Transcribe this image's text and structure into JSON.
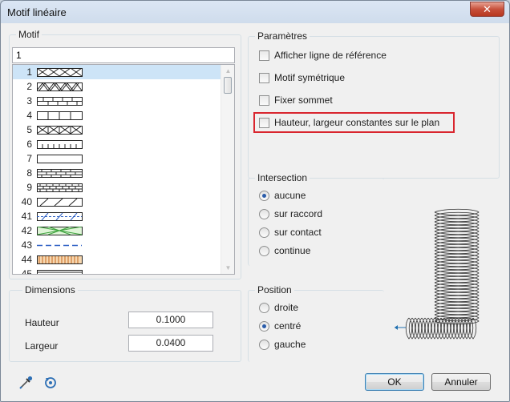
{
  "window": {
    "title": "Motif linéaire",
    "close_glyph": "✕"
  },
  "motif": {
    "group_title": "Motif",
    "search_value": "1",
    "items": [
      {
        "num": "1",
        "pattern": "diamond-lattice"
      },
      {
        "num": "2",
        "pattern": "zigzag-double"
      },
      {
        "num": "3",
        "pattern": "brick-double"
      },
      {
        "num": "4",
        "pattern": "rect-blocks"
      },
      {
        "num": "5",
        "pattern": "cross-blocks"
      },
      {
        "num": "6",
        "pattern": "comb"
      },
      {
        "num": "7",
        "pattern": "empty"
      },
      {
        "num": "8",
        "pattern": "brick-triple"
      },
      {
        "num": "9",
        "pattern": "brick-dense"
      },
      {
        "num": "40",
        "pattern": "diagonal-hatch"
      },
      {
        "num": "41",
        "pattern": "diagonal-blue"
      },
      {
        "num": "42",
        "pattern": "green-cross"
      },
      {
        "num": "43",
        "pattern": "dash-blue"
      },
      {
        "num": "44",
        "pattern": "orange-rail"
      },
      {
        "num": "45",
        "pattern": "stripes"
      }
    ]
  },
  "parametres": {
    "group_title": "Paramètres",
    "afficher_label": "Afficher ligne de référence",
    "symetrique_label": "Motif symétrique",
    "fixer_label": "Fixer sommet",
    "hauteur_constante_label": "Hauteur, largeur constantes sur le plan",
    "highlight_color": "#d9252e"
  },
  "intersection": {
    "group_title": "Intersection",
    "options": [
      "aucune",
      "sur raccord",
      "sur contact",
      "continue"
    ],
    "selected": "aucune"
  },
  "dimensions": {
    "group_title": "Dimensions",
    "hauteur_label": "Hauteur",
    "hauteur_value": "0.1000",
    "largeur_label": "Largeur",
    "largeur_value": "0.0400"
  },
  "position": {
    "group_title": "Position",
    "options": [
      "droite",
      "centré",
      "gauche"
    ],
    "selected": "centré"
  },
  "footer": {
    "ok_label": "OK",
    "cancel_label": "Annuler",
    "icons": [
      "eyedropper-icon",
      "reset-icon"
    ]
  },
  "colors": {
    "accent_blue": "#2a5caa",
    "selection": "#cde4f7"
  }
}
